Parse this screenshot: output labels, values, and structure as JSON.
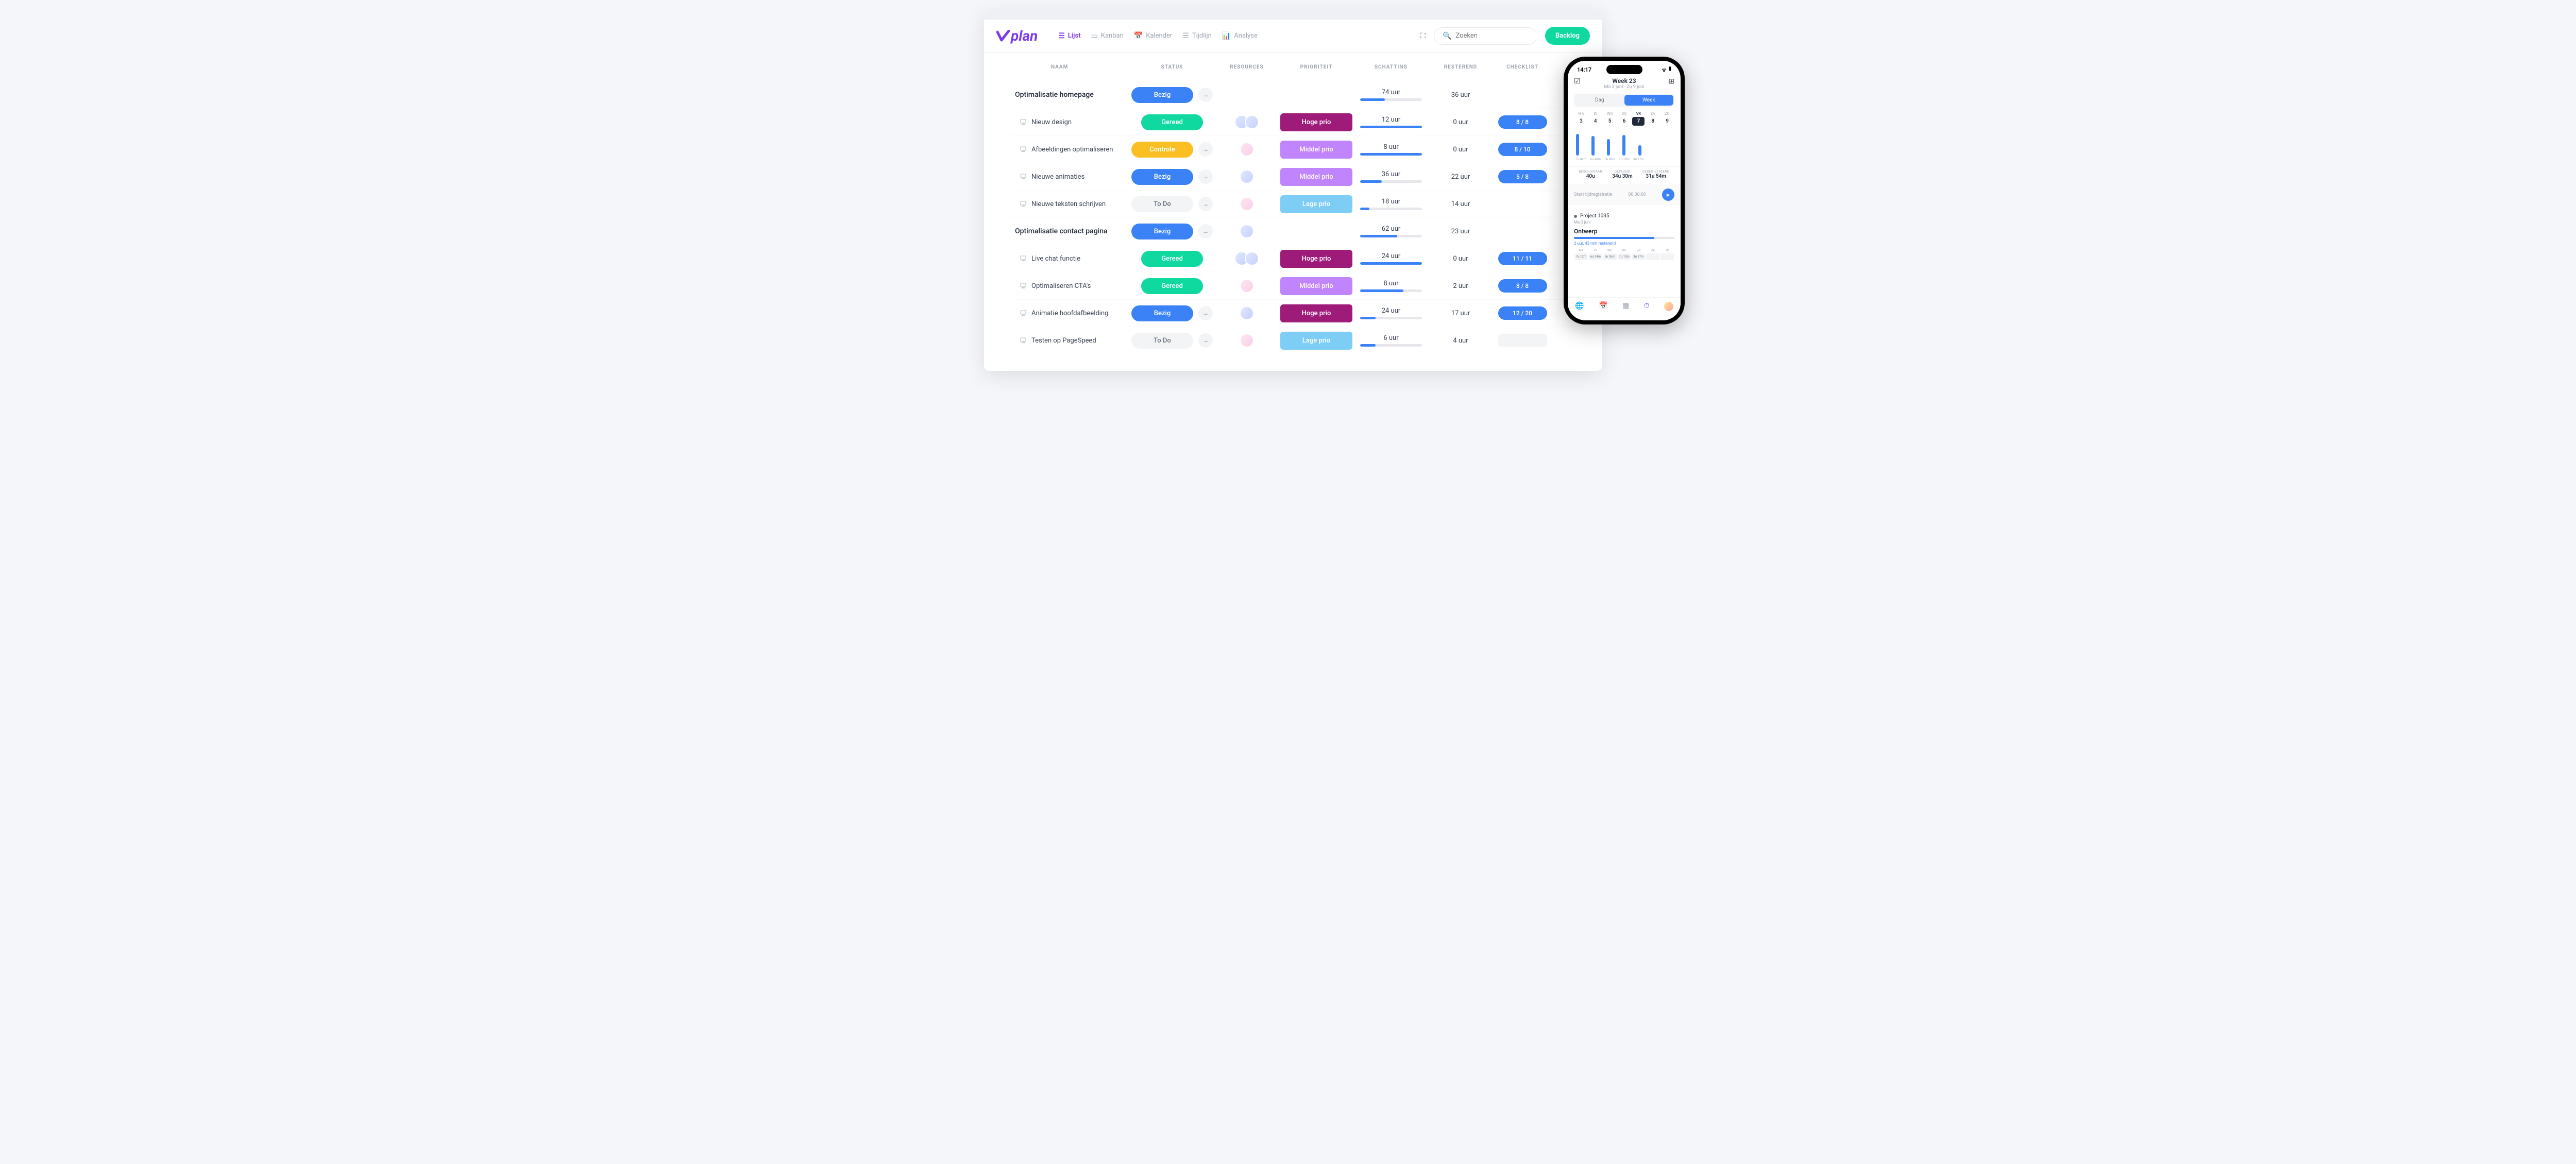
{
  "logo": "plan",
  "views": [
    {
      "label": "Lijst",
      "active": true
    },
    {
      "label": "Kanban",
      "active": false
    },
    {
      "label": "Kalender",
      "active": false
    },
    {
      "label": "Tijdlijn",
      "active": false
    },
    {
      "label": "Analyse",
      "active": false
    }
  ],
  "search_placeholder": "Zoeken",
  "backlog_label": "Backlog",
  "columns": {
    "naam": "NAAM",
    "status": "STATUS",
    "resources": "RESOURCES",
    "prioriteit": "PRIORITEIT",
    "schatting": "SCHATTING",
    "resterend": "RESTEREND",
    "checklist": "CHECKLIST"
  },
  "rows": [
    {
      "type": "group",
      "naam": "Optimalisatie homepage",
      "status": "Bezig",
      "status_class": "bezig",
      "arrow": true,
      "resources": [],
      "prio": null,
      "est": "74 uur",
      "est_pct": 40,
      "rest": "36 uur",
      "check": null
    },
    {
      "type": "sub",
      "naam": "Nieuw design",
      "status": "Gereed",
      "status_class": "gereed",
      "arrow": false,
      "resources": [
        "m",
        "m"
      ],
      "prio": "Hoge prio",
      "prio_class": "hoge",
      "est": "12 uur",
      "est_pct": 100,
      "rest": "0 uur",
      "check": "8 / 8"
    },
    {
      "type": "sub",
      "naam": "Afbeeldingen optimaliseren",
      "status": "Controle",
      "status_class": "controle",
      "arrow": true,
      "resources": [
        "f"
      ],
      "prio": "Middel prio",
      "prio_class": "middel",
      "est": "8 uur",
      "est_pct": 100,
      "rest": "0 uur",
      "check": "8 / 10"
    },
    {
      "type": "sub",
      "naam": "Nieuwe animaties",
      "status": "Bezig",
      "status_class": "bezig",
      "arrow": true,
      "resources": [
        "m"
      ],
      "prio": "Middel prio",
      "prio_class": "middel",
      "est": "36 uur",
      "est_pct": 35,
      "rest": "22 uur",
      "check": "5 / 8"
    },
    {
      "type": "sub",
      "naam": "Nieuwe teksten schrijven",
      "status": "To Do",
      "status_class": "todo",
      "arrow": true,
      "resources": [
        "f"
      ],
      "prio": "Lage prio",
      "prio_class": "lage",
      "est": "18 uur",
      "est_pct": 15,
      "rest": "14 uur",
      "check": null
    },
    {
      "type": "group",
      "naam": "Optimalisatie contact pagina",
      "status": "Bezig",
      "status_class": "bezig",
      "arrow": true,
      "resources": [
        "m"
      ],
      "prio": null,
      "est": "62 uur",
      "est_pct": 60,
      "rest": "23 uur",
      "check": null
    },
    {
      "type": "sub",
      "naam": "Live chat functie",
      "status": "Gereed",
      "status_class": "gereed",
      "arrow": false,
      "resources": [
        "m",
        "m"
      ],
      "prio": "Hoge prio",
      "prio_class": "hoge",
      "est": "24 uur",
      "est_pct": 100,
      "rest": "0 uur",
      "check": "11 / 11"
    },
    {
      "type": "sub",
      "naam": "Optimaliseren CTA's",
      "status": "Gereed",
      "status_class": "gereed",
      "arrow": false,
      "resources": [
        "f"
      ],
      "prio": "Middel prio",
      "prio_class": "middel",
      "est": "8 uur",
      "est_pct": 70,
      "rest": "2 uur",
      "check": "8 / 8"
    },
    {
      "type": "sub",
      "naam": "Animatie hoofdafbeelding",
      "status": "Bezig",
      "status_class": "bezig",
      "arrow": true,
      "resources": [
        "m"
      ],
      "prio": "Hoge prio",
      "prio_class": "hoge",
      "est": "24 uur",
      "est_pct": 25,
      "rest": "17 uur",
      "check": "12 / 20"
    },
    {
      "type": "sub",
      "naam": "Testen op PageSpeed",
      "status": "To Do",
      "status_class": "todo",
      "arrow": true,
      "resources": [
        "f"
      ],
      "prio": "Lage prio",
      "prio_class": "lage",
      "est": "6 uur",
      "est_pct": 25,
      "rest": "4 uur",
      "check": "placeholder"
    }
  ],
  "phone": {
    "time": "14:17",
    "week_title": "Week 23",
    "date_range": "Ma 3 juni - Zo 9 juni",
    "seg_dag": "Dag",
    "seg_week": "Week",
    "days": [
      {
        "lbl": "MA",
        "num": "3"
      },
      {
        "lbl": "DI",
        "num": "4"
      },
      {
        "lbl": "WO",
        "num": "5"
      },
      {
        "lbl": "DO",
        "num": "6"
      },
      {
        "lbl": "VR",
        "num": "7",
        "active": true
      },
      {
        "lbl": "ZA",
        "num": "8"
      },
      {
        "lbl": "ZO",
        "num": "9"
      }
    ],
    "bar_heights": [
      42,
      38,
      32,
      40,
      20,
      0,
      0
    ],
    "bar_times": [
      "7u 42m",
      "6u 48m",
      "5u 36m",
      "7u 12m",
      "3u 17m",
      "",
      ""
    ],
    "stats": [
      {
        "label": "BESCHIKBAAR",
        "value": "40u"
      },
      {
        "label": "GEPLAND",
        "value": "34u 30m"
      },
      {
        "label": "GEREGISTREERD",
        "value": "31u 54m"
      }
    ],
    "timer_label": "Start tijdregistratie",
    "timer_time": "00:00:00",
    "project_name": "Project 1035",
    "project_date": "Ma 3 juni",
    "project_task": "Ontwerp",
    "project_remaining": "2 uur, 43 min resterend",
    "project_day_labels": [
      "MA",
      "DI",
      "WO",
      "DO",
      "VR",
      "ZA",
      "ZO"
    ],
    "project_days": [
      "7u 12m",
      "6u 24m",
      "5u 36m",
      "7u 12m",
      "3u 17m",
      "",
      ""
    ]
  }
}
